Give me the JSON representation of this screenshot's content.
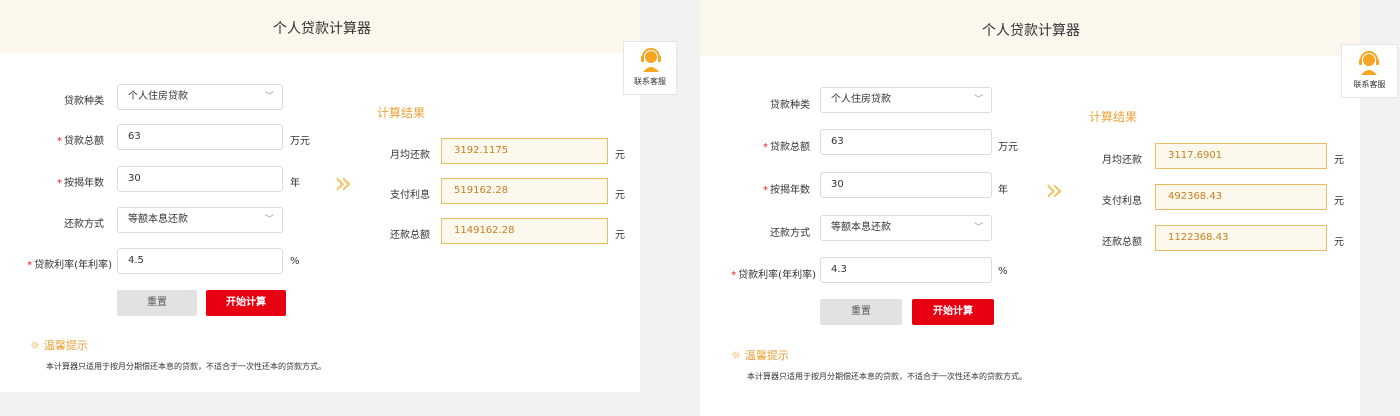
{
  "panels": [
    {
      "title": "个人贷款计算器",
      "form": {
        "loan_type_label": "贷款种类",
        "loan_type_value": "个人住房贷款",
        "amount_label": "贷款总额",
        "amount_value": "63",
        "amount_unit": "万元",
        "years_label": "按揭年数",
        "years_value": "30",
        "years_unit": "年",
        "method_label": "还款方式",
        "method_value": "等额本息还款",
        "rate_label": "贷款利率(年利率)",
        "rate_value": "4.5",
        "rate_unit": "%",
        "required_mark": "*"
      },
      "buttons": {
        "reset": "重置",
        "calculate": "开始计算"
      },
      "arrow": "»",
      "results": {
        "title": "计算结果",
        "monthly_label": "月均还款",
        "monthly_value": "3192.1175",
        "interest_label": "支付利息",
        "interest_value": "519162.28",
        "total_label": "还款总额",
        "total_value": "1149162.28",
        "unit": "元"
      },
      "tips": {
        "title": "温馨提示",
        "text": "本计算器只适用于按月分期偿还本息的贷款，不适合于一次性还本的贷款方式。"
      }
    },
    {
      "title": "个人贷款计算器",
      "form": {
        "loan_type_label": "贷款种类",
        "loan_type_value": "个人住房贷款",
        "amount_label": "贷款总额",
        "amount_value": "63",
        "amount_unit": "万元",
        "years_label": "按揭年数",
        "years_value": "30",
        "years_unit": "年",
        "method_label": "还款方式",
        "method_value": "等额本息还款",
        "rate_label": "贷款利率(年利率)",
        "rate_value": "4.3",
        "rate_unit": "%",
        "required_mark": "*"
      },
      "buttons": {
        "reset": "重置",
        "calculate": "开始计算"
      },
      "arrow": "»",
      "results": {
        "title": "计算结果",
        "monthly_label": "月均还款",
        "monthly_value": "3117.6901",
        "interest_label": "支付利息",
        "interest_value": "492368.43",
        "total_label": "还款总额",
        "total_value": "1122368.43",
        "unit": "元"
      },
      "tips": {
        "title": "温馨提示",
        "text": "本计算器只适用于按月分期偿还本息的贷款，不适合于一次性还本的贷款方式。"
      }
    }
  ],
  "customer_service": {
    "label": "联系客服",
    "icon": "headset-icon",
    "color": "#f5a623"
  },
  "chevron": "﹀",
  "colors": {
    "accent": "#e9a23b",
    "primary_button": "#e60012",
    "header_bg": "#fcf7ed"
  }
}
